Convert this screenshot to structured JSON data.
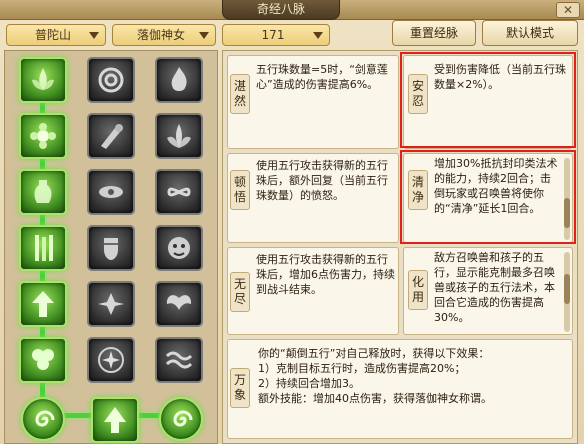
{
  "window": {
    "title": "奇经八脉",
    "close_label": "✕"
  },
  "toolbar": {
    "school_dropdown": "普陀山",
    "role_dropdown": "落伽神女",
    "level_dropdown": "171",
    "reset_button": "重置经脉",
    "default_button": "默认模式"
  },
  "grid": {
    "icons": [
      [
        "lotus-icon",
        "swirl-icon",
        "flame-icon"
      ],
      [
        "bloom-icon",
        "brush-icon",
        "petal-icon"
      ],
      [
        "vase-icon",
        "orb-icon",
        "knot-icon"
      ],
      [
        "bamboo-icon",
        "fist-icon",
        "beast-icon"
      ],
      [
        "arrow-up-icon",
        "flower-icon",
        "wings-icon"
      ],
      [
        "clover-icon",
        "star-icon",
        "wave-icon"
      ],
      [
        "spiral-icon",
        "tree-icon",
        "spiral-icon"
      ]
    ]
  },
  "descriptions": {
    "zhanran": {
      "name": "湛然",
      "text": "五行珠数量=5时，“剑意莲心”造成的伤害提高6%。"
    },
    "anren": {
      "name": "安忍",
      "text": "受到伤害降低（当前五行珠数量×2%）。"
    },
    "dunwu": {
      "name": "顿悟",
      "text": "使用五行攻击获得新的五行珠后，额外回复（当前五行珠数量）的愤怒。"
    },
    "qingjing": {
      "name": "清净",
      "text": "增加30%抵抗封印类法术的能力，持续2回合；击倒玩家或召唤兽将使你的“清净”延长1回合。"
    },
    "wujin": {
      "name": "无尽",
      "text": "使用五行攻击获得新的五行珠后，增加6点伤害力，持续到战斗结束。"
    },
    "huayong": {
      "name": "化用",
      "text": "敌方召唤兽和孩子的五行，显示能克制最多召唤兽或孩子的五行法术，本回合它造成的伤害提高30%。"
    },
    "wanxiang": {
      "name": "万象",
      "lines": [
        "你的“颠倒五行”对自己释放时，获得以下效果：",
        "1）克制目标五行时，造成伤害提高20%；",
        "2）持续回合增加3。",
        "额外技能：增加40点伤害，获得落伽神女称谓。"
      ]
    }
  }
}
